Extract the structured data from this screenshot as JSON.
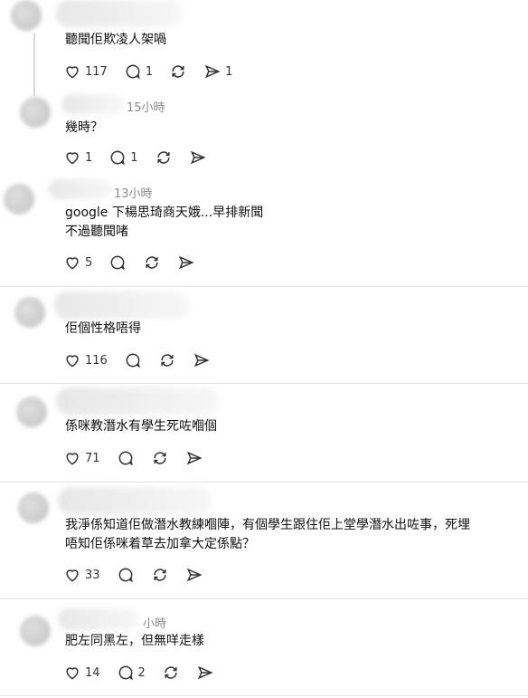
{
  "posts": [
    {
      "time": "",
      "text": "聽聞佢欺凌人架喎",
      "likes": "117",
      "replies": "1",
      "shares": "1"
    },
    {
      "time": "15小時",
      "text": "幾時？",
      "likes": "1",
      "replies": "1",
      "shares": ""
    },
    {
      "time": "13小時",
      "text": "google 下楊思琦商天娥...早排新聞\n不過聽聞啫",
      "likes": "5",
      "replies": "",
      "shares": ""
    },
    {
      "time": "",
      "text": "佢個性格唔得",
      "likes": "116",
      "replies": "",
      "shares": ""
    },
    {
      "time": "",
      "text": "係咪教潛水有學生死咗嗰個",
      "likes": "71",
      "replies": "",
      "shares": ""
    },
    {
      "time": "",
      "text": "我淨係知道佢做潛水教練嗰陣，有個學生跟住佢上堂學潛水出咗事，死埋\n唔知佢係咪着草去加拿大定係點？",
      "likes": "33",
      "replies": "",
      "shares": ""
    },
    {
      "time": "小時",
      "text": "肥左同黑左，但無咩走樣",
      "likes": "14",
      "replies": "2",
      "shares": ""
    }
  ],
  "icons": {
    "like": "heart-icon",
    "reply": "comment-icon",
    "repost": "repost-icon",
    "share": "send-icon"
  }
}
